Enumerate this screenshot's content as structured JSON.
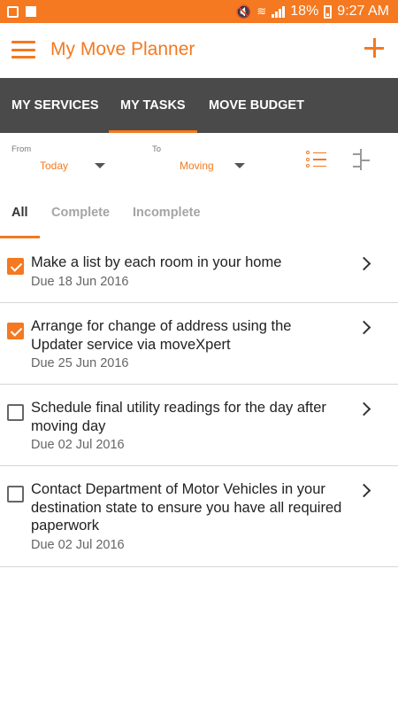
{
  "status_bar": {
    "battery_percent": "18%",
    "time": "9:27 AM",
    "icons": [
      "gallery-icon",
      "flipboard-icon",
      "mute-icon",
      "wifi-icon",
      "signal-icon",
      "battery-icon"
    ]
  },
  "app_bar": {
    "title": "My Move Planner",
    "menu_icon": "hamburger-menu-icon",
    "add_icon": "plus-icon"
  },
  "main_tabs": [
    {
      "label": "MY SERVICES",
      "active": false
    },
    {
      "label": "MY TASKS",
      "active": true
    },
    {
      "label": "MOVE BUDGET",
      "active": false
    }
  ],
  "filters": {
    "from_label": "From",
    "from_value": "Today",
    "to_label": "To",
    "to_value": "Moving",
    "view_icon": "list-view-icon",
    "sort_icon": "sort-icon"
  },
  "sub_tabs": [
    {
      "label": "All",
      "active": true
    },
    {
      "label": "Complete",
      "active": false
    },
    {
      "label": "Incomplete",
      "active": false
    }
  ],
  "tasks": [
    {
      "title": "Make a list by each room in your home",
      "due": "Due 18 Jun 2016",
      "checked": true
    },
    {
      "title": "Arrange for change of address using the Updater service via moveXpert",
      "due": "Due 25 Jun 2016",
      "checked": true
    },
    {
      "title": "Schedule final utility readings for the day after moving day",
      "due": "Due 02 Jul 2016",
      "checked": false
    },
    {
      "title": "Contact Department of Motor Vehicles in your destination state to ensure you have all required paperwork",
      "due": "Due 02 Jul 2016",
      "checked": false
    }
  ],
  "colors": {
    "accent": "#f47920",
    "tab_bar": "#4a4a4a",
    "divider": "#d6d6d6"
  }
}
